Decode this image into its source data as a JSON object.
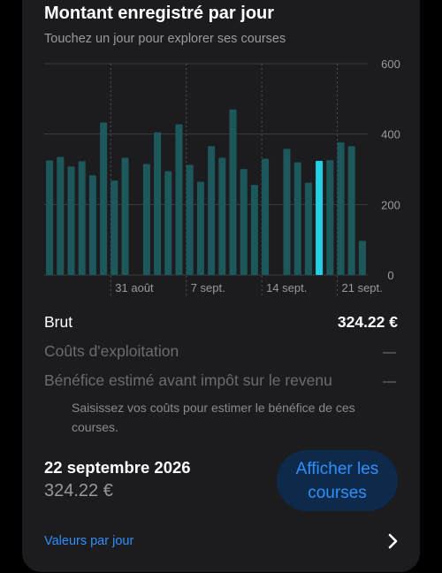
{
  "header": {
    "title": "Montant enregistré par jour",
    "subtitle": "Touchez un jour pour explorer ses courses"
  },
  "chart_data": {
    "type": "bar",
    "title": "",
    "xlabel": "",
    "ylabel": "",
    "ylim": [
      0,
      600
    ],
    "y_ticks": [
      "600",
      "400",
      "200",
      "0"
    ],
    "y_tick_values": [
      600,
      400,
      200,
      0
    ],
    "x_tick_labels": [
      "31 août",
      "7 sept.",
      "14 sept.",
      "21 sept."
    ],
    "x_tick_bar_index": [
      6,
      13,
      20,
      27
    ],
    "values": [
      325,
      335,
      308,
      323,
      283,
      433,
      268,
      333,
      0,
      315,
      405,
      295,
      428,
      313,
      265,
      366,
      333,
      470,
      301,
      256,
      330,
      0,
      358,
      320,
      262,
      324.22,
      326,
      377,
      366,
      97
    ],
    "selected_index": 25,
    "colors": {
      "bar": "#1d585c",
      "selected_bar": "#23d0e4",
      "grid": "#3c3c3e",
      "tick_label": "#9a9a9f"
    },
    "grid": true
  },
  "summary": {
    "gross_label": "Brut",
    "gross_value": "324.22 €",
    "operating_costs_label": "Coûts d'exploitation",
    "estimated_profit_label": "Bénéfice estimé avant impôt sur le revenu",
    "hint": "Saisissez vos coûts pour estimer le bénéfice de ces courses."
  },
  "selected_day": {
    "date": "22 septembre 2026",
    "amount": "324.22 €",
    "button_label": "Afficher les courses"
  },
  "footer": {
    "link_label": "Valeurs par jour",
    "chevron_icon": "chevron-right-icon"
  }
}
